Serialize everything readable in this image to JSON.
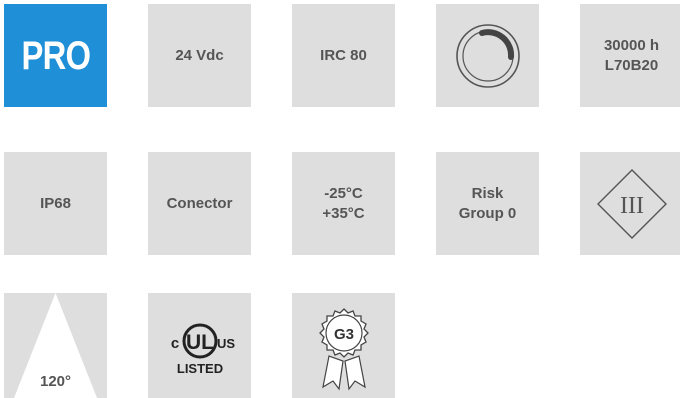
{
  "row1": {
    "pro": "PRO",
    "voltage": "24 Vdc",
    "cri": "IRC 80",
    "dimmer_icon": "dimmer-knob-icon",
    "lifetime_line1": "30000 h",
    "lifetime_line2": "L70B20"
  },
  "row2": {
    "ip": "IP68",
    "connector": "Conector",
    "temp_line1": "-25°C",
    "temp_line2": "+35°C",
    "risk_line1": "Risk",
    "risk_line2": "Group 0",
    "class_icon": "class-iii-diamond-icon",
    "class_text": "III"
  },
  "row3": {
    "beam_angle": "120°",
    "beam_icon": "beam-angle-icon",
    "ul_c": "c",
    "ul_mark": "UL",
    "ul_us": "US",
    "ul_listed": "LISTED",
    "ul_icon": "ul-listed-icon",
    "g3_label": "G3",
    "g3_icon": "rosette-badge-icon"
  },
  "colors": {
    "tile_bg": "#dedede",
    "pro_bg": "#1f8fd8",
    "text": "#555555"
  }
}
